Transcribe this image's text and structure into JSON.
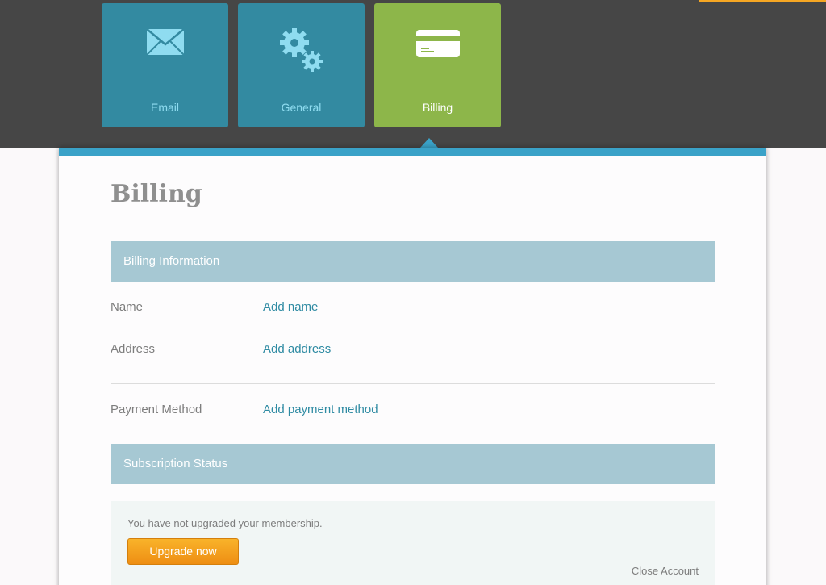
{
  "tabs": [
    {
      "label": "Email",
      "icon": "envelope-icon"
    },
    {
      "label": "General",
      "icon": "gears-icon"
    },
    {
      "label": "Billing",
      "icon": "credit-card-icon",
      "active": true
    }
  ],
  "page": {
    "title": "Billing"
  },
  "billing_info": {
    "header": "Billing Information",
    "rows": [
      {
        "label": "Name",
        "link": "Add name"
      },
      {
        "label": "Address",
        "link": "Add address"
      },
      {
        "label": "Payment Method",
        "link": "Add payment method"
      }
    ]
  },
  "subscription": {
    "header": "Subscription Status",
    "message": "You have not upgraded your membership.",
    "upgrade_label": "Upgrade now",
    "close_label": "Close Account"
  },
  "colors": {
    "topbar": "#464646",
    "tab_blue": "#338aa1",
    "tab_green": "#8db64a",
    "accent_blue": "#3aa2c8",
    "link": "#2f8ba3",
    "section_header": "#a6c8d3",
    "upgrade_button": "#ee8e13"
  }
}
